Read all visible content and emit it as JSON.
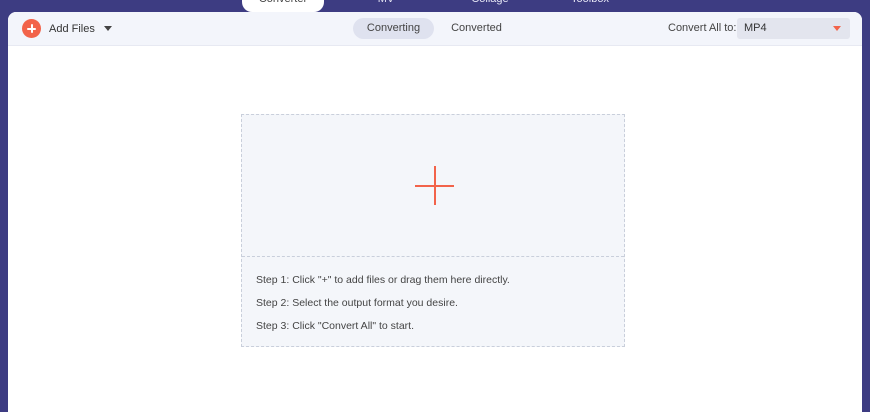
{
  "top_tabs": [
    "Converter",
    "MV",
    "Collage",
    "Toolbox"
  ],
  "toolbar": {
    "add_files_label": "Add Files",
    "mode_tabs": [
      "Converting",
      "Converted"
    ],
    "convert_all_label": "Convert All to:",
    "format_value": "MP4"
  },
  "drop_zone": {
    "steps": [
      "Step 1: Click \"+\" to add files or drag them here directly.",
      "Step 2: Select the output format you desire.",
      "Step 3: Click \"Convert All\" to start."
    ]
  },
  "colors": {
    "background": "#3d3c82",
    "accent": "#f2634a",
    "toolbar": "#f3f5fb",
    "drop_zone": "#f4f6fa"
  },
  "icons": [
    "add-files-plus-icon",
    "dropdown-caret-icon",
    "format-dropdown-arrow-icon",
    "big-plus-icon"
  ]
}
